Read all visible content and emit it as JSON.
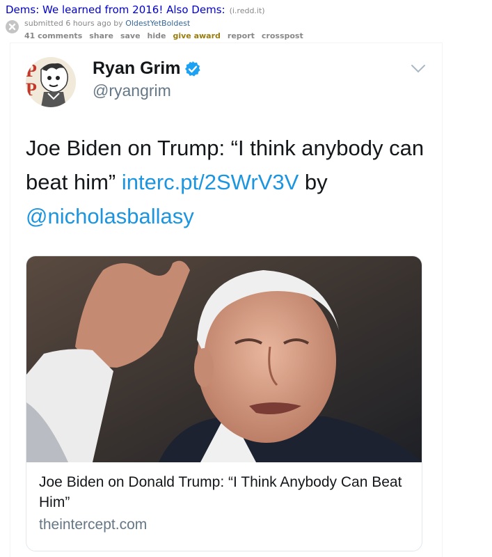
{
  "post": {
    "title": "Dems: We learned from 2016! Also Dems:",
    "domain": "(i.redd.it)",
    "submitted_prefix": "submitted 6 hours ago by ",
    "author": "OldestYetBoldest",
    "buttons": {
      "comments": "41 comments",
      "share": "share",
      "save": "save",
      "hide": "hide",
      "give_award": "give award",
      "report": "report",
      "crosspost": "crosspost"
    }
  },
  "tweet": {
    "name": "Ryan Grim",
    "handle": "@ryangrim",
    "text_plain": "Joe Biden on Trump: “I think anybody can beat him” ",
    "link_url": "interc.pt/2SWrV3V",
    "text_by": " by ",
    "mention": "@nicholasballasy",
    "card": {
      "title": "Joe Biden on Donald Trump: “I Think Anybody Can Beat Him”",
      "domain": "theintercept.com"
    }
  }
}
